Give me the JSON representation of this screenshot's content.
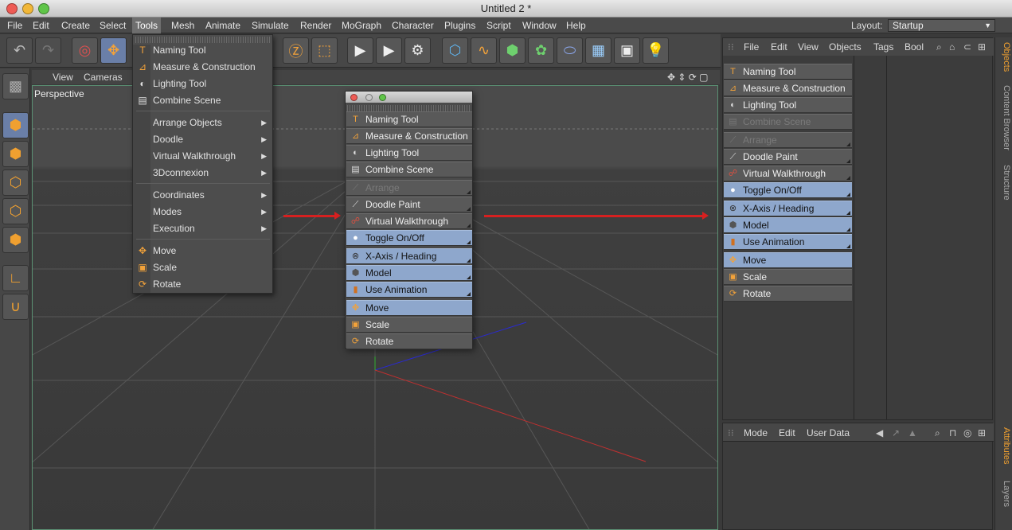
{
  "window": {
    "title": "Untitled 2 *"
  },
  "menubar": {
    "items": [
      "File",
      "Edit",
      "Create",
      "Select",
      "Tools",
      "Mesh",
      "Animate",
      "Simulate",
      "Render",
      "MoGraph",
      "Character",
      "Plugins",
      "Script",
      "Window",
      "Help"
    ],
    "active": "Tools",
    "layout_label": "Layout:",
    "layout_value": "Startup"
  },
  "viewport": {
    "menu": [
      "View",
      "Cameras"
    ],
    "label": "Perspective"
  },
  "tools_menu": {
    "group1": [
      "Naming Tool",
      "Measure & Construction",
      "Lighting Tool",
      "Combine Scene"
    ],
    "group2": [
      "Arrange Objects",
      "Doodle",
      "Virtual Walkthrough",
      "3Dconnexion"
    ],
    "group3": [
      "Coordinates",
      "Modes",
      "Execution"
    ],
    "group4": [
      "Move",
      "Scale",
      "Rotate"
    ]
  },
  "palette": {
    "group1": [
      "Naming Tool",
      "Measure & Construction",
      "Lighting Tool",
      "Combine Scene"
    ],
    "group2": [
      "Arrange",
      "Doodle Paint",
      "Virtual Walkthrough",
      "Toggle On/Off"
    ],
    "group3": [
      "X-Axis / Heading",
      "Model",
      "Use Animation"
    ],
    "group4": [
      "Move",
      "Scale",
      "Rotate"
    ]
  },
  "docked": {
    "group1": [
      "Naming Tool",
      "Measure & Construction",
      "Lighting Tool",
      "Combine Scene"
    ],
    "group2": [
      "Arrange",
      "Doodle Paint",
      "Virtual Walkthrough",
      "Toggle On/Off"
    ],
    "group3": [
      "X-Axis / Heading",
      "Model",
      "Use Animation"
    ],
    "group4": [
      "Move",
      "Scale",
      "Rotate"
    ]
  },
  "objects_panel": {
    "menu": [
      "File",
      "Edit",
      "View",
      "Objects",
      "Tags",
      "Bool"
    ]
  },
  "attributes_panel": {
    "menu": [
      "Mode",
      "Edit",
      "User Data"
    ]
  },
  "side_tabs": [
    "Objects",
    "Content Browser",
    "Structure",
    "Attributes",
    "Layers"
  ],
  "colors": {
    "accent": "#8ea7cc",
    "icon": "#f2a23a",
    "arrow": "#d62020"
  }
}
